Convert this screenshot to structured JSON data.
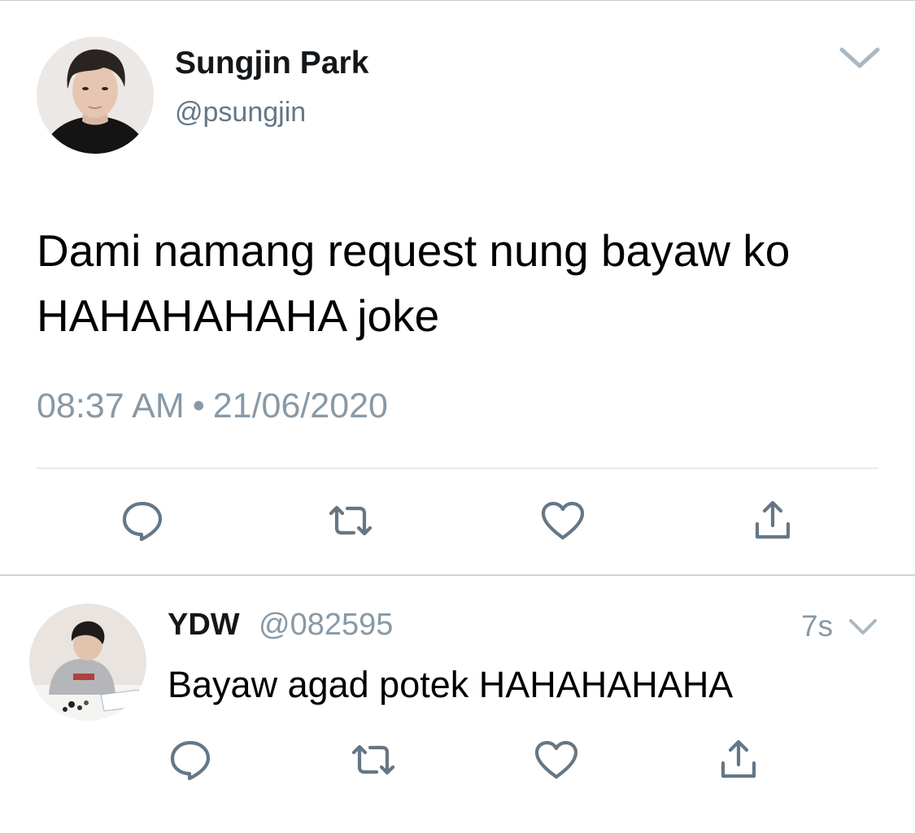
{
  "main_tweet": {
    "display_name": "Sungjin Park",
    "handle": "@psungjin",
    "text": "Dami namang request nung bayaw ko HAHAHAHAHA joke",
    "time": "08:37 AM",
    "separator": "•",
    "date": "21/06/2020",
    "icons": {
      "menu": "chevron-down-icon",
      "reply": "reply-icon",
      "retweet": "retweet-icon",
      "like": "heart-icon",
      "share": "share-icon"
    }
  },
  "reply": {
    "display_name": "YDW",
    "handle": "@082595",
    "relative_time": "7s",
    "text": "Bayaw agad potek HAHAHAHAHA",
    "icons": {
      "menu": "chevron-down-icon",
      "reply": "reply-icon",
      "retweet": "retweet-icon",
      "like": "heart-icon",
      "share": "share-icon"
    }
  },
  "colors": {
    "primary_text": "#14171a",
    "secondary_text": "#657786",
    "meta_text": "#8899a6",
    "icon": "#657786",
    "divider": "#d8dde1"
  }
}
